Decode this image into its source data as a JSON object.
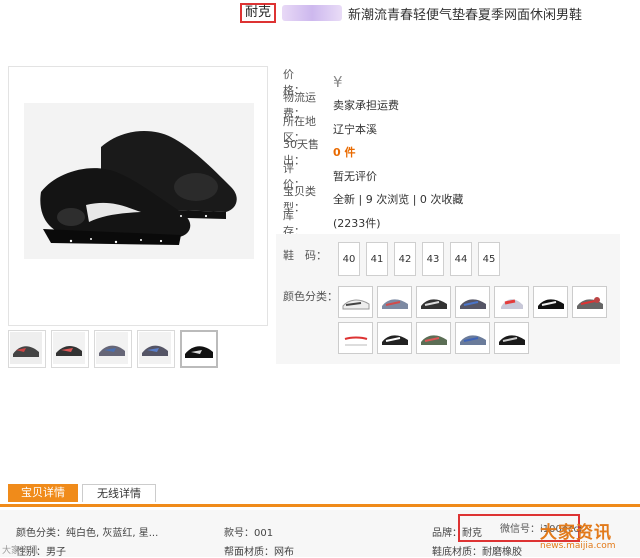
{
  "title": {
    "brand": "耐克",
    "rest": "新潮流青春轻便气垫春夏季网面休闲男鞋"
  },
  "props": [
    {
      "key": "价　　格：",
      "value": "¥",
      "style": "yen"
    },
    {
      "key": "物流运费：",
      "value": "卖家承担运费",
      "style": ""
    },
    {
      "key": "所在地区：",
      "value": "辽宁本溪",
      "style": ""
    },
    {
      "key": "30天售出：",
      "value": "0 件",
      "style": "orange"
    },
    {
      "key": "评　　价：",
      "value": "暂无评价",
      "style": ""
    },
    {
      "key": "宝贝类型：",
      "value": "全新 | 9 次浏览 | 0 次收藏",
      "style": ""
    },
    {
      "key": "库　　存：",
      "value": "(2233件)",
      "style": ""
    }
  ],
  "options": {
    "size_label": "鞋　码：",
    "sizes": [
      "40",
      "41",
      "42",
      "43",
      "44",
      "45"
    ],
    "color_label": "颜色分类："
  },
  "colors": {
    "accent": "#f08b1a",
    "highlight": "#dd3333",
    "panel": "#f6f6f6"
  },
  "tabs": [
    "宝贝详情",
    "无线详情"
  ],
  "details": {
    "color_class": "颜色分类：纯白色, 灰蓝红, 星...",
    "style_no": "款号：001",
    "brand": "品牌：耐克",
    "gender": "性别：男子",
    "upper_material": "帮面材质：网布",
    "sole_material": "鞋底材质：耐磨橡胶"
  },
  "overlay": {
    "wechat_text": "微信号：i100eccr",
    "watermark_top": "大家资讯",
    "watermark_url": "news.maijia.com",
    "watermark_left": "大家资讯"
  }
}
